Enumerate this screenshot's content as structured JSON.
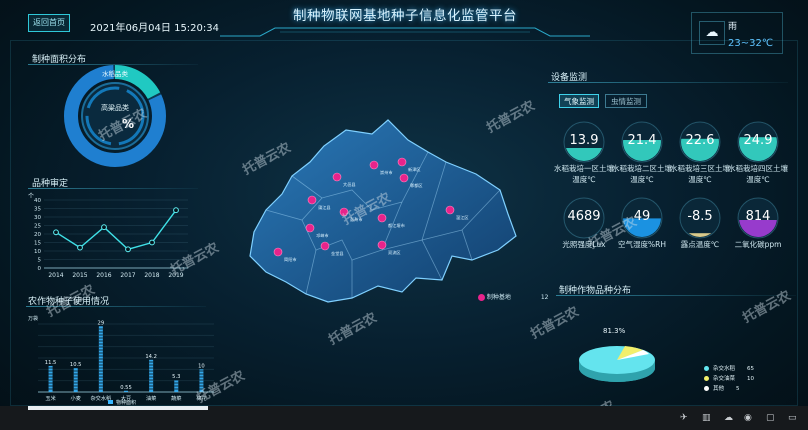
{
  "header": {
    "home_button": "返回首页",
    "datetime": "2021年06月04日  15:20:34",
    "title": "制种物联网基地种子信息化监管平台"
  },
  "weather": {
    "icon": "cloud-icon",
    "condition": "雨",
    "temp_range": "23~32℃"
  },
  "sections": {
    "distribution": "制种面积分布",
    "variety_trend": "品种审定",
    "seed_usage": "农作物种子使用情况",
    "device_monitor": "设备监测",
    "crop_variety_dist": "制种作物品种分布"
  },
  "distribution_donut": {
    "labels": [
      "水稻品类",
      "高粱品类"
    ],
    "center_value": "%",
    "fractions": [
      0.18,
      0.82
    ]
  },
  "variety_chart": {
    "type": "line",
    "unit": "个",
    "categories": [
      "2014",
      "2015",
      "2016",
      "2017",
      "2018",
      "2019"
    ],
    "values": [
      21,
      12,
      24,
      11,
      15,
      34
    ],
    "ylim": [
      0,
      40
    ],
    "yticks": [
      "0",
      "5",
      "10",
      "15",
      "20",
      "25",
      "30",
      "35",
      "40"
    ]
  },
  "seed_usage_chart": {
    "type": "bar",
    "unit": "万袋",
    "categories": [
      "玉米",
      "小麦",
      "杂交水稻",
      "大豆",
      "油菜",
      "蔬菜",
      "棉花"
    ],
    "values": [
      11.5,
      10.5,
      29,
      0.55,
      14.2,
      5.3,
      10
    ],
    "value_labels": [
      "11.5",
      "10.5",
      "29",
      "0.55",
      "14.2",
      "5.3",
      "10"
    ],
    "ylim": [
      0,
      30
    ],
    "legend": "物种面积"
  },
  "map": {
    "legend_label": "制种基地",
    "legend_count": "12",
    "districts": [
      "大邑县",
      "崇州市",
      "新津区",
      "蒲江县",
      "邛崃市",
      "彭州市",
      "都江堰市",
      "郫都区",
      "温江区",
      "双流区",
      "金堂县",
      "简阳市"
    ]
  },
  "device_tabs": [
    "气象监测",
    "虫情监测"
  ],
  "gauges_row1": [
    {
      "value": "13.9",
      "label": "水稻栽培一区土壤温度℃",
      "fill": 0.35,
      "color": "#39e5d2"
    },
    {
      "value": "21.4",
      "label": "水稻栽培二区土壤温度℃",
      "fill": 0.55,
      "color": "#39e5d2"
    },
    {
      "value": "22.6",
      "label": "水稻栽培三区土壤温度℃",
      "fill": 0.58,
      "color": "#39e5d2"
    },
    {
      "value": "24.9",
      "label": "水稻栽培四区土壤温度℃",
      "fill": 0.62,
      "color": "#39e5d2"
    }
  ],
  "gauges_row2": [
    {
      "value": "4689",
      "label": "光照强度Lux",
      "fill": 0.0,
      "color": "#1fa6ff"
    },
    {
      "value": "49",
      "label": "空气湿度%RH",
      "fill": 0.49,
      "color": "#1fa6ff"
    },
    {
      "value": "-8.5",
      "label": "露点温度℃",
      "fill": 0.12,
      "color": "#ffe79a"
    },
    {
      "value": "814",
      "label": "二氧化碳ppm",
      "fill": 0.45,
      "color": "#b040e6"
    }
  ],
  "pie": {
    "percent_label": "81.3%",
    "legend": [
      {
        "name": "杂交水稻",
        "count": "65",
        "color": "#63e6f0"
      },
      {
        "name": "杂交油菜",
        "count": "10",
        "color": "#f2ef6b"
      },
      {
        "name": "其他",
        "count": "5",
        "color": "#ffffff"
      }
    ]
  },
  "watermark": "托普云农",
  "taskbar_icons": [
    "rocket-icon",
    "trash-icon",
    "cloud-sync-icon",
    "speaker-icon",
    "lock-icon",
    "chat-icon"
  ]
}
